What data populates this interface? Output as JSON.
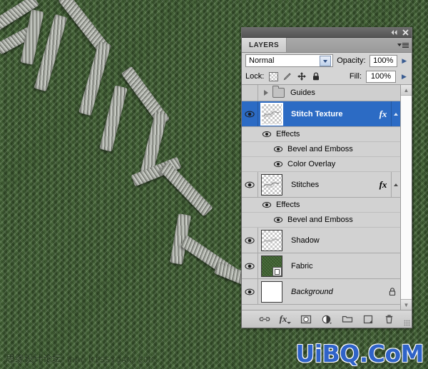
{
  "app": {
    "panel_title": "LAYERS",
    "titlebar_icons": [
      "collapse-icon",
      "close-icon"
    ]
  },
  "blend": {
    "mode": "Normal",
    "opacity_label": "Opacity:",
    "opacity_value": "100%",
    "fill_label": "Fill:",
    "fill_value": "100%"
  },
  "lock": {
    "label": "Lock:",
    "icons": [
      "lock-transparent-pixels-icon",
      "lock-image-pixels-icon",
      "lock-position-icon",
      "lock-all-icon"
    ]
  },
  "layers": [
    {
      "name": "Guides",
      "type": "group",
      "visible": false,
      "selected": false,
      "expanded": false
    },
    {
      "name": "Stitch Texture",
      "type": "layer",
      "visible": true,
      "selected": true,
      "has_fx": true,
      "thumb": "transparent",
      "effects_label": "Effects",
      "effects": [
        "Bevel and Emboss",
        "Color Overlay"
      ]
    },
    {
      "name": "Stitches",
      "type": "layer",
      "visible": true,
      "selected": false,
      "has_fx": true,
      "thumb": "transparent",
      "effects_label": "Effects",
      "effects": [
        "Bevel and Emboss"
      ]
    },
    {
      "name": "Shadow",
      "type": "layer",
      "visible": true,
      "selected": false,
      "has_fx": false,
      "thumb": "transparent",
      "effects": []
    },
    {
      "name": "Fabric",
      "type": "layer",
      "visible": true,
      "selected": false,
      "has_fx": false,
      "thumb": "green-smart-object",
      "effects": []
    },
    {
      "name": "Background",
      "type": "layer",
      "visible": true,
      "selected": false,
      "has_fx": false,
      "locked": true,
      "italic": true,
      "thumb": "white",
      "effects": []
    }
  ],
  "bottom_toolbar": [
    "link-layers-icon",
    "add-layer-style-icon",
    "add-layer-mask-icon",
    "new-adjustment-layer-icon",
    "new-group-icon",
    "new-layer-icon",
    "delete-layer-icon"
  ],
  "scrollbar": {
    "up_arrow": "scroll-up-icon",
    "down_arrow": "scroll-down-icon"
  },
  "watermarks": {
    "forum_cn": "思缘设计论坛",
    "forum_url": "WWW.MISSYUAN.COM",
    "logo": "UiBQ.CoM"
  },
  "colors": {
    "selection_blue": "#2c6bc4",
    "panel_gray": "#d5d5d5",
    "fabric_green": "#3f5d33",
    "logo_blue": "#2f63c8"
  }
}
